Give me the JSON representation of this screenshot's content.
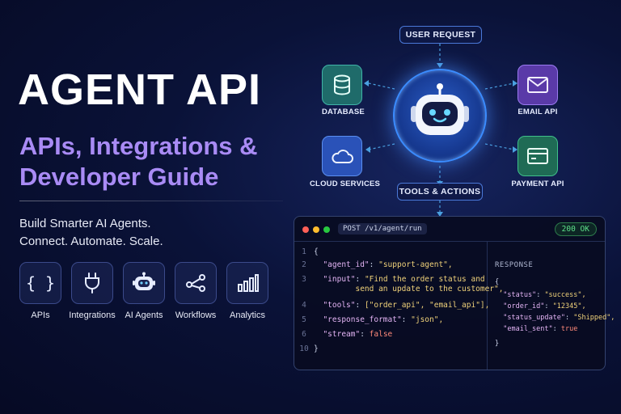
{
  "hero": {
    "title": "AGENT API",
    "subtitle": "APIs, Integrations & Developer Guide",
    "tagline_line1": "Build Smarter AI Agents.",
    "tagline_line2": "Connect. Automate. Scale."
  },
  "features": [
    {
      "label": "APIs",
      "icon": "braces-icon"
    },
    {
      "label": "Integrations",
      "icon": "plug-icon"
    },
    {
      "label": "AI Agents",
      "icon": "robot-icon"
    },
    {
      "label": "Workflows",
      "icon": "workflow-icon"
    },
    {
      "label": "Analytics",
      "icon": "bar-chart-icon"
    }
  ],
  "diagram": {
    "top_label": "USER REQUEST",
    "bottom_label": "TOOLS & ACTIONS",
    "nodes": {
      "database": "DATABASE",
      "email": "EMAIL API",
      "cloud": "CLOUD SERVICES",
      "payment": "PAYMENT API"
    },
    "colors": {
      "database": "#1f6b6a",
      "email": "#5a3aa8",
      "cloud": "#2a52b8",
      "payment": "#1f6b55"
    }
  },
  "code_panel": {
    "endpoint": "POST /v1/agent/run",
    "status": "200 OK",
    "request_lines": [
      {
        "n": "1",
        "text": "{"
      },
      {
        "n": "2",
        "key": "\"agent_id\"",
        "value": "\"support-agent\","
      },
      {
        "n": "3",
        "key": "\"input\"",
        "value": "\"Find the order status and"
      },
      {
        "n": "",
        "cont": "send an update to the customer\","
      },
      {
        "n": "4",
        "key": "\"tools\"",
        "value": "[\"order_api\", \"email_api\"],"
      },
      {
        "n": "5",
        "key": "\"response_format\"",
        "value": "\"json\","
      },
      {
        "n": "6",
        "key": "\"stream\"",
        "value": "false"
      },
      {
        "n": "10",
        "text": "}"
      }
    ],
    "response_title": "RESPONSE",
    "response_lines": [
      {
        "text": "{"
      },
      {
        "key": "\"status\"",
        "value": "\"success\","
      },
      {
        "key": "\"order_id\"",
        "value": "\"12345\","
      },
      {
        "key": "\"status_update\"",
        "value": "\"Shipped\","
      },
      {
        "key": "\"email_sent\"",
        "value": "true"
      },
      {
        "text": "}"
      }
    ]
  }
}
